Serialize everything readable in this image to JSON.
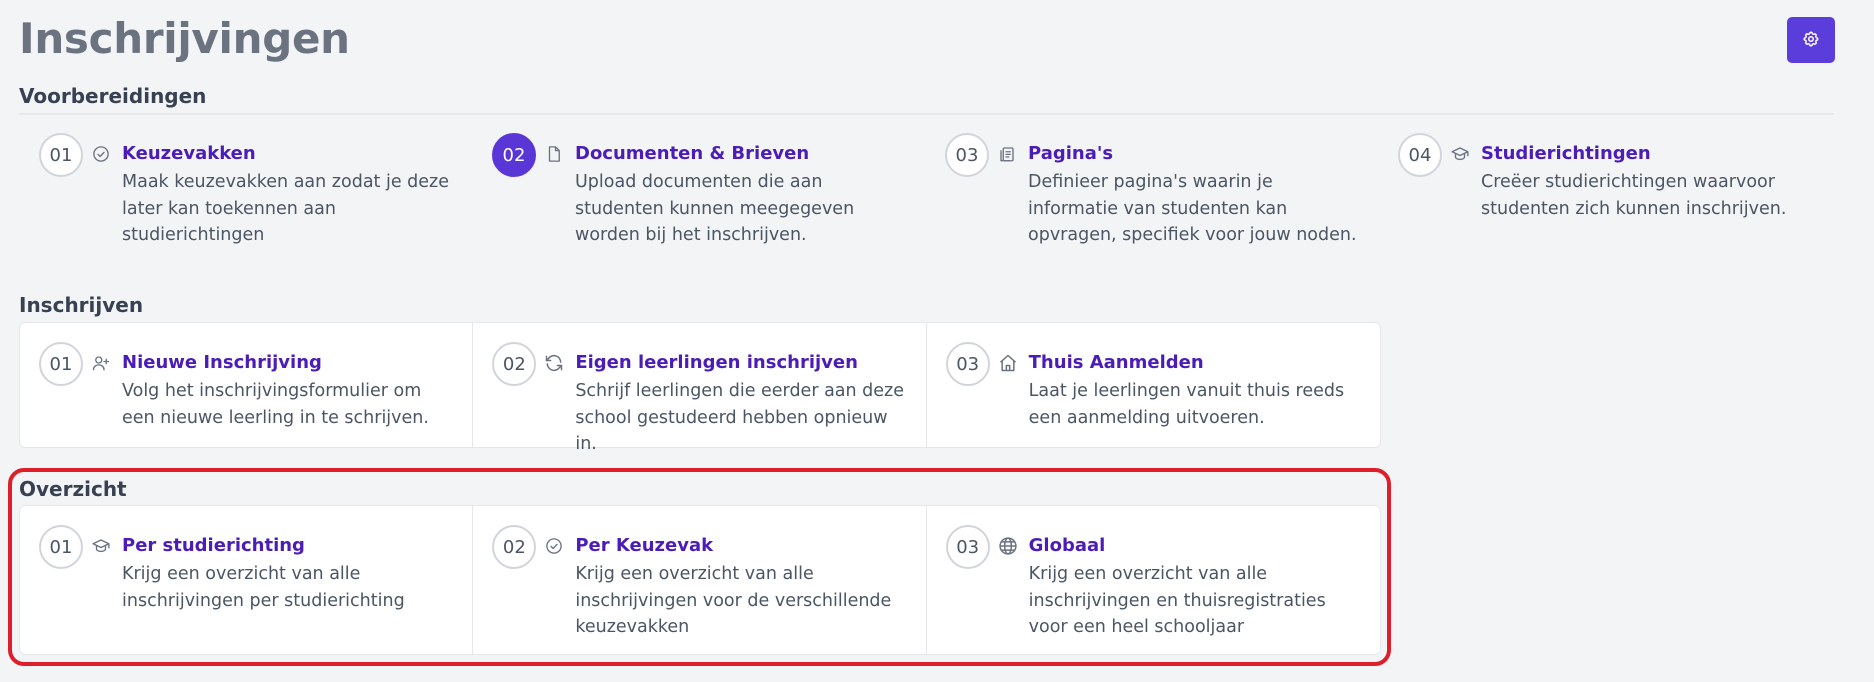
{
  "page": {
    "title": "Inschrijvingen"
  },
  "header": {
    "settings_icon": "gear-icon",
    "accent": "#5b3ddb"
  },
  "sections": [
    {
      "title": "Voorbereidingen",
      "cards": [
        {
          "number": "01",
          "icon": "check-circle-icon",
          "title": "Keuzevakken",
          "description": "Maak keuzevakken aan zodat je deze later kan toekennen aan studierichtingen",
          "active": false
        },
        {
          "number": "02",
          "icon": "document-icon",
          "title": "Documenten & Brieven",
          "description": "Upload documenten die aan studenten kunnen meegegeven worden bij het inschrijven.",
          "active": true
        },
        {
          "number": "03",
          "icon": "clipboard-icon",
          "title": "Pagina's",
          "description": "Definieer pagina's waarin je informatie van studenten kan opvragen, specifiek voor jouw noden.",
          "active": false
        },
        {
          "number": "04",
          "icon": "graduation-cap-icon",
          "title": "Studierichtingen",
          "description": "Creëer studierichtingen waarvoor studenten zich kunnen inschrijven.",
          "active": false
        }
      ]
    },
    {
      "title": "Inschrijven",
      "cards": [
        {
          "number": "01",
          "icon": "user-plus-icon",
          "title": "Nieuwe Inschrijving",
          "description": "Volg het inschrijvingsformulier om een nieuwe leerling in te schrijven.",
          "active": false
        },
        {
          "number": "02",
          "icon": "refresh-icon",
          "title": "Eigen leerlingen inschrijven",
          "description": "Schrijf leerlingen die eerder aan deze school gestudeerd hebben opnieuw in.",
          "active": false
        },
        {
          "number": "03",
          "icon": "home-icon",
          "title": "Thuis Aanmelden",
          "description": "Laat je leerlingen vanuit thuis reeds een aanmelding uitvoeren.",
          "active": false
        }
      ]
    },
    {
      "title": "Overzicht",
      "cards": [
        {
          "number": "01",
          "icon": "graduation-cap-icon",
          "title": "Per studierichting",
          "description": "Krijg een overzicht van alle inschrijvingen per studierichting",
          "active": false
        },
        {
          "number": "02",
          "icon": "check-circle-icon",
          "title": "Per Keuzevak",
          "description": "Krijg een overzicht van alle inschrijvingen voor de verschillende keuzevakken",
          "active": false
        },
        {
          "number": "03",
          "icon": "globe-icon",
          "title": "Globaal",
          "description": "Krijg een overzicht van alle inschrijvingen en thuisregistraties voor een heel schooljaar",
          "active": false
        }
      ]
    }
  ]
}
